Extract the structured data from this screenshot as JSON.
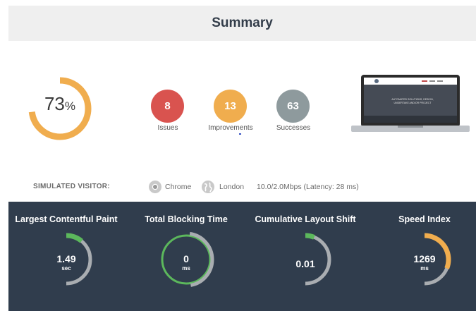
{
  "header": {
    "title": "Summary"
  },
  "score": {
    "value": "73",
    "unit": "%",
    "fraction": 0.73,
    "color": "#f0ad4e"
  },
  "stats": [
    {
      "count": "8",
      "label": "Issues",
      "color": "#d9534f"
    },
    {
      "count": "13",
      "label": "Improvements",
      "color": "#f0ad4e"
    },
    {
      "count": "63",
      "label": "Successes",
      "color": "#8e9a9d"
    }
  ],
  "preview": {
    "screen_text": "AUTOMATED SOLUTIONS, DESIGN, UNDERTAKE AND/OR PROJECT"
  },
  "visitor": {
    "label": "SIMULATED VISITOR:",
    "browser": "Chrome",
    "location": "London",
    "connection": "10.0/2.0Mbps (Latency: 28 ms)"
  },
  "metrics": [
    {
      "title": "Largest Contentful Paint",
      "value": "1.49",
      "unit": "sec",
      "level": 0.22,
      "color": "#5cb85c"
    },
    {
      "title": "Total Blocking Time",
      "value": "0",
      "unit": "ms",
      "level": 1.0,
      "color": "#5cb85c"
    },
    {
      "title": "Cumulative Layout Shift",
      "value": "0.01",
      "unit": "",
      "level": 0.12,
      "color": "#5cb85c"
    },
    {
      "title": "Speed Index",
      "value": "1269",
      "unit": "ms",
      "level": 0.62,
      "color": "#f0ad4e"
    }
  ]
}
